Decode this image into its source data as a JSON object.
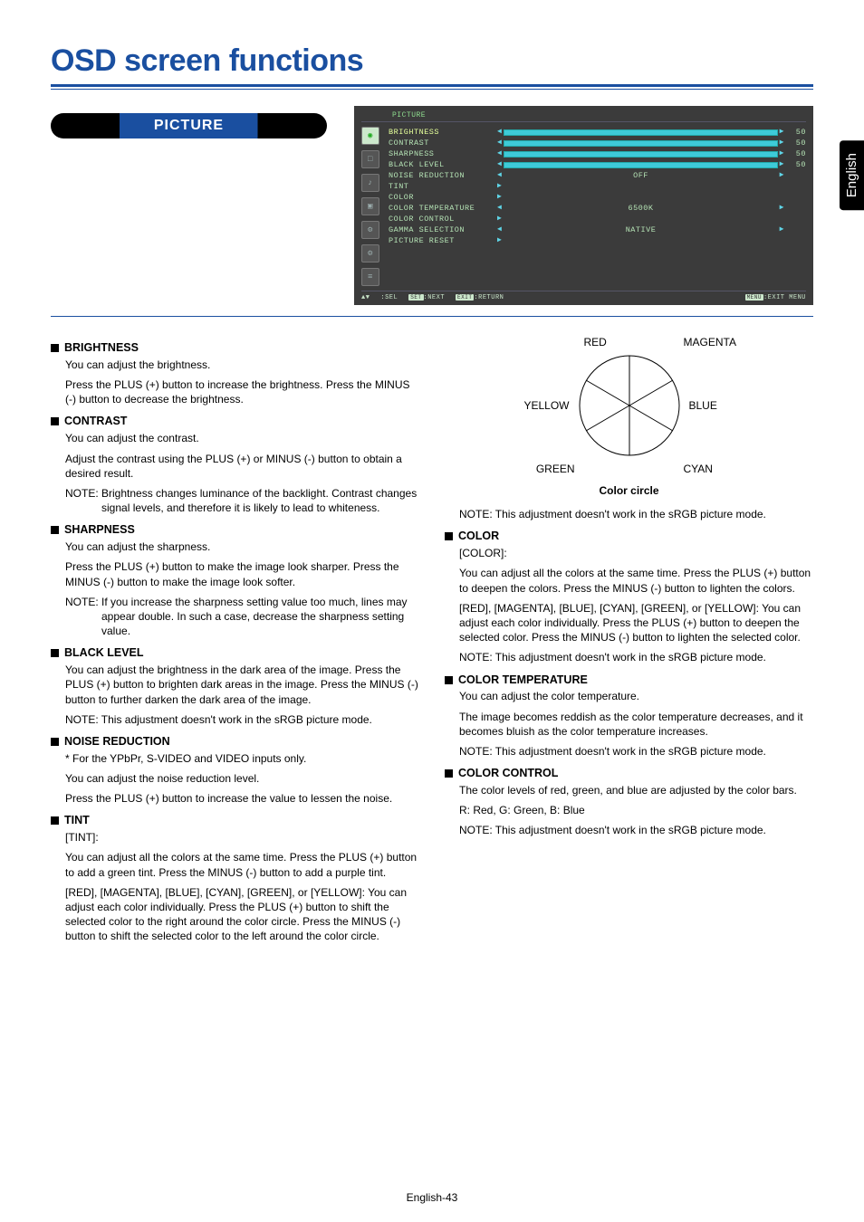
{
  "page": {
    "title": "OSD screen functions",
    "section": "PICTURE",
    "langTab": "English",
    "pageNumber": "English-43"
  },
  "osd": {
    "header": "PICTURE",
    "rows": [
      {
        "label": "BRIGHTNESS",
        "type": "slider",
        "value": "50",
        "hl": true
      },
      {
        "label": "CONTRAST",
        "type": "slider",
        "value": "50"
      },
      {
        "label": "SHARPNESS",
        "type": "slider",
        "value": "50"
      },
      {
        "label": "BLACK LEVEL",
        "type": "slider",
        "value": "50"
      },
      {
        "label": "NOISE REDUCTION",
        "type": "enum",
        "value": "OFF"
      },
      {
        "label": "TINT",
        "type": "submenu"
      },
      {
        "label": "COLOR",
        "type": "submenu"
      },
      {
        "label": "COLOR TEMPERATURE",
        "type": "enum",
        "value": "6500K"
      },
      {
        "label": "COLOR CONTROL",
        "type": "submenu"
      },
      {
        "label": "GAMMA SELECTION",
        "type": "enum",
        "value": "NATIVE"
      },
      {
        "label": "PICTURE RESET",
        "type": "submenu"
      }
    ],
    "footer": {
      "sel": ":SEL",
      "nextBtn": "SET",
      "next": ":NEXT",
      "returnBtn": "EXIT",
      "ret": ":RETURN",
      "exitBtn": "MENU",
      "exit": ":EXIT MENU"
    }
  },
  "left": [
    {
      "title": "BRIGHTNESS",
      "paras": [
        "You can adjust the brightness.",
        "Press the PLUS (+) button to increase the brightness. Press the MINUS (-) button to decrease the brightness."
      ]
    },
    {
      "title": "CONTRAST",
      "paras": [
        "You can adjust the contrast.",
        "Adjust the contrast using the PLUS (+) or MINUS (-) button to obtain a desired result."
      ],
      "notes": [
        "NOTE: Brightness changes luminance of the backlight. Contrast changes signal levels, and therefore it is likely to lead to whiteness."
      ]
    },
    {
      "title": "SHARPNESS",
      "paras": [
        "You can adjust the sharpness.",
        "Press the PLUS (+) button to make the image look sharper. Press the MINUS (-) button to make the image look softer."
      ],
      "notes": [
        "NOTE: If you increase the sharpness setting value too much, lines may appear double. In such a case, decrease the sharpness setting value."
      ]
    },
    {
      "title": "BLACK LEVEL",
      "paras": [
        "You can adjust the brightness in the dark area of the image. Press the PLUS (+) button to brighten dark areas in the image. Press the MINUS (-) button to further darken the dark area of the image."
      ],
      "notes": [
        "NOTE: This adjustment doesn't work in the sRGB picture mode."
      ]
    },
    {
      "title": "NOISE REDUCTION",
      "paras": [
        "  * For the YPbPr, S-VIDEO and VIDEO inputs only.",
        "You can adjust the noise reduction level.",
        "Press the PLUS (+) button to increase the value to lessen the noise."
      ]
    },
    {
      "title": "TINT",
      "paras": [
        "[TINT]:",
        "You can adjust all the colors at the same time. Press the PLUS (+) button to add a green tint. Press the MINUS (-) button to add a purple tint.",
        "[RED], [MAGENTA], [BLUE], [CYAN], [GREEN], or [YELLOW]: You can adjust each color individually. Press the PLUS (+) button to shift the selected color to the right around the color circle. Press the MINUS (-) button to shift the selected color to the left around the color circle."
      ]
    }
  ],
  "wheel": {
    "red": "RED",
    "magenta": "MAGENTA",
    "yellow": "YELLOW",
    "blue": "BLUE",
    "green": "GREEN",
    "cyan": "CYAN",
    "caption": "Color circle"
  },
  "rightNote": "NOTE: This adjustment doesn't work in the sRGB picture mode.",
  "right": [
    {
      "title": "COLOR",
      "paras": [
        "[COLOR]:",
        "You can adjust all the colors at the same time. Press the PLUS (+) button to deepen the colors. Press the MINUS (-) button to lighten the colors.",
        "[RED], [MAGENTA], [BLUE], [CYAN], [GREEN], or [YELLOW]: You can adjust each color individually. Press the PLUS (+) button to deepen the selected color. Press the MINUS (-) button to lighten the selected color."
      ],
      "notes": [
        "NOTE: This adjustment doesn't work in the sRGB picture mode."
      ]
    },
    {
      "title": "COLOR TEMPERATURE",
      "paras": [
        "You can adjust the color temperature.",
        "The image becomes reddish as the color temperature decreases, and it becomes bluish as the color temperature increases."
      ],
      "notes": [
        "NOTE: This adjustment doesn't work in the sRGB picture mode."
      ]
    },
    {
      "title": "COLOR CONTROL",
      "paras": [
        "The color levels of red, green, and blue are adjusted by the color bars.",
        "R: Red, G: Green, B: Blue"
      ],
      "notes": [
        "NOTE: This adjustment doesn't work in the sRGB picture mode."
      ]
    }
  ]
}
